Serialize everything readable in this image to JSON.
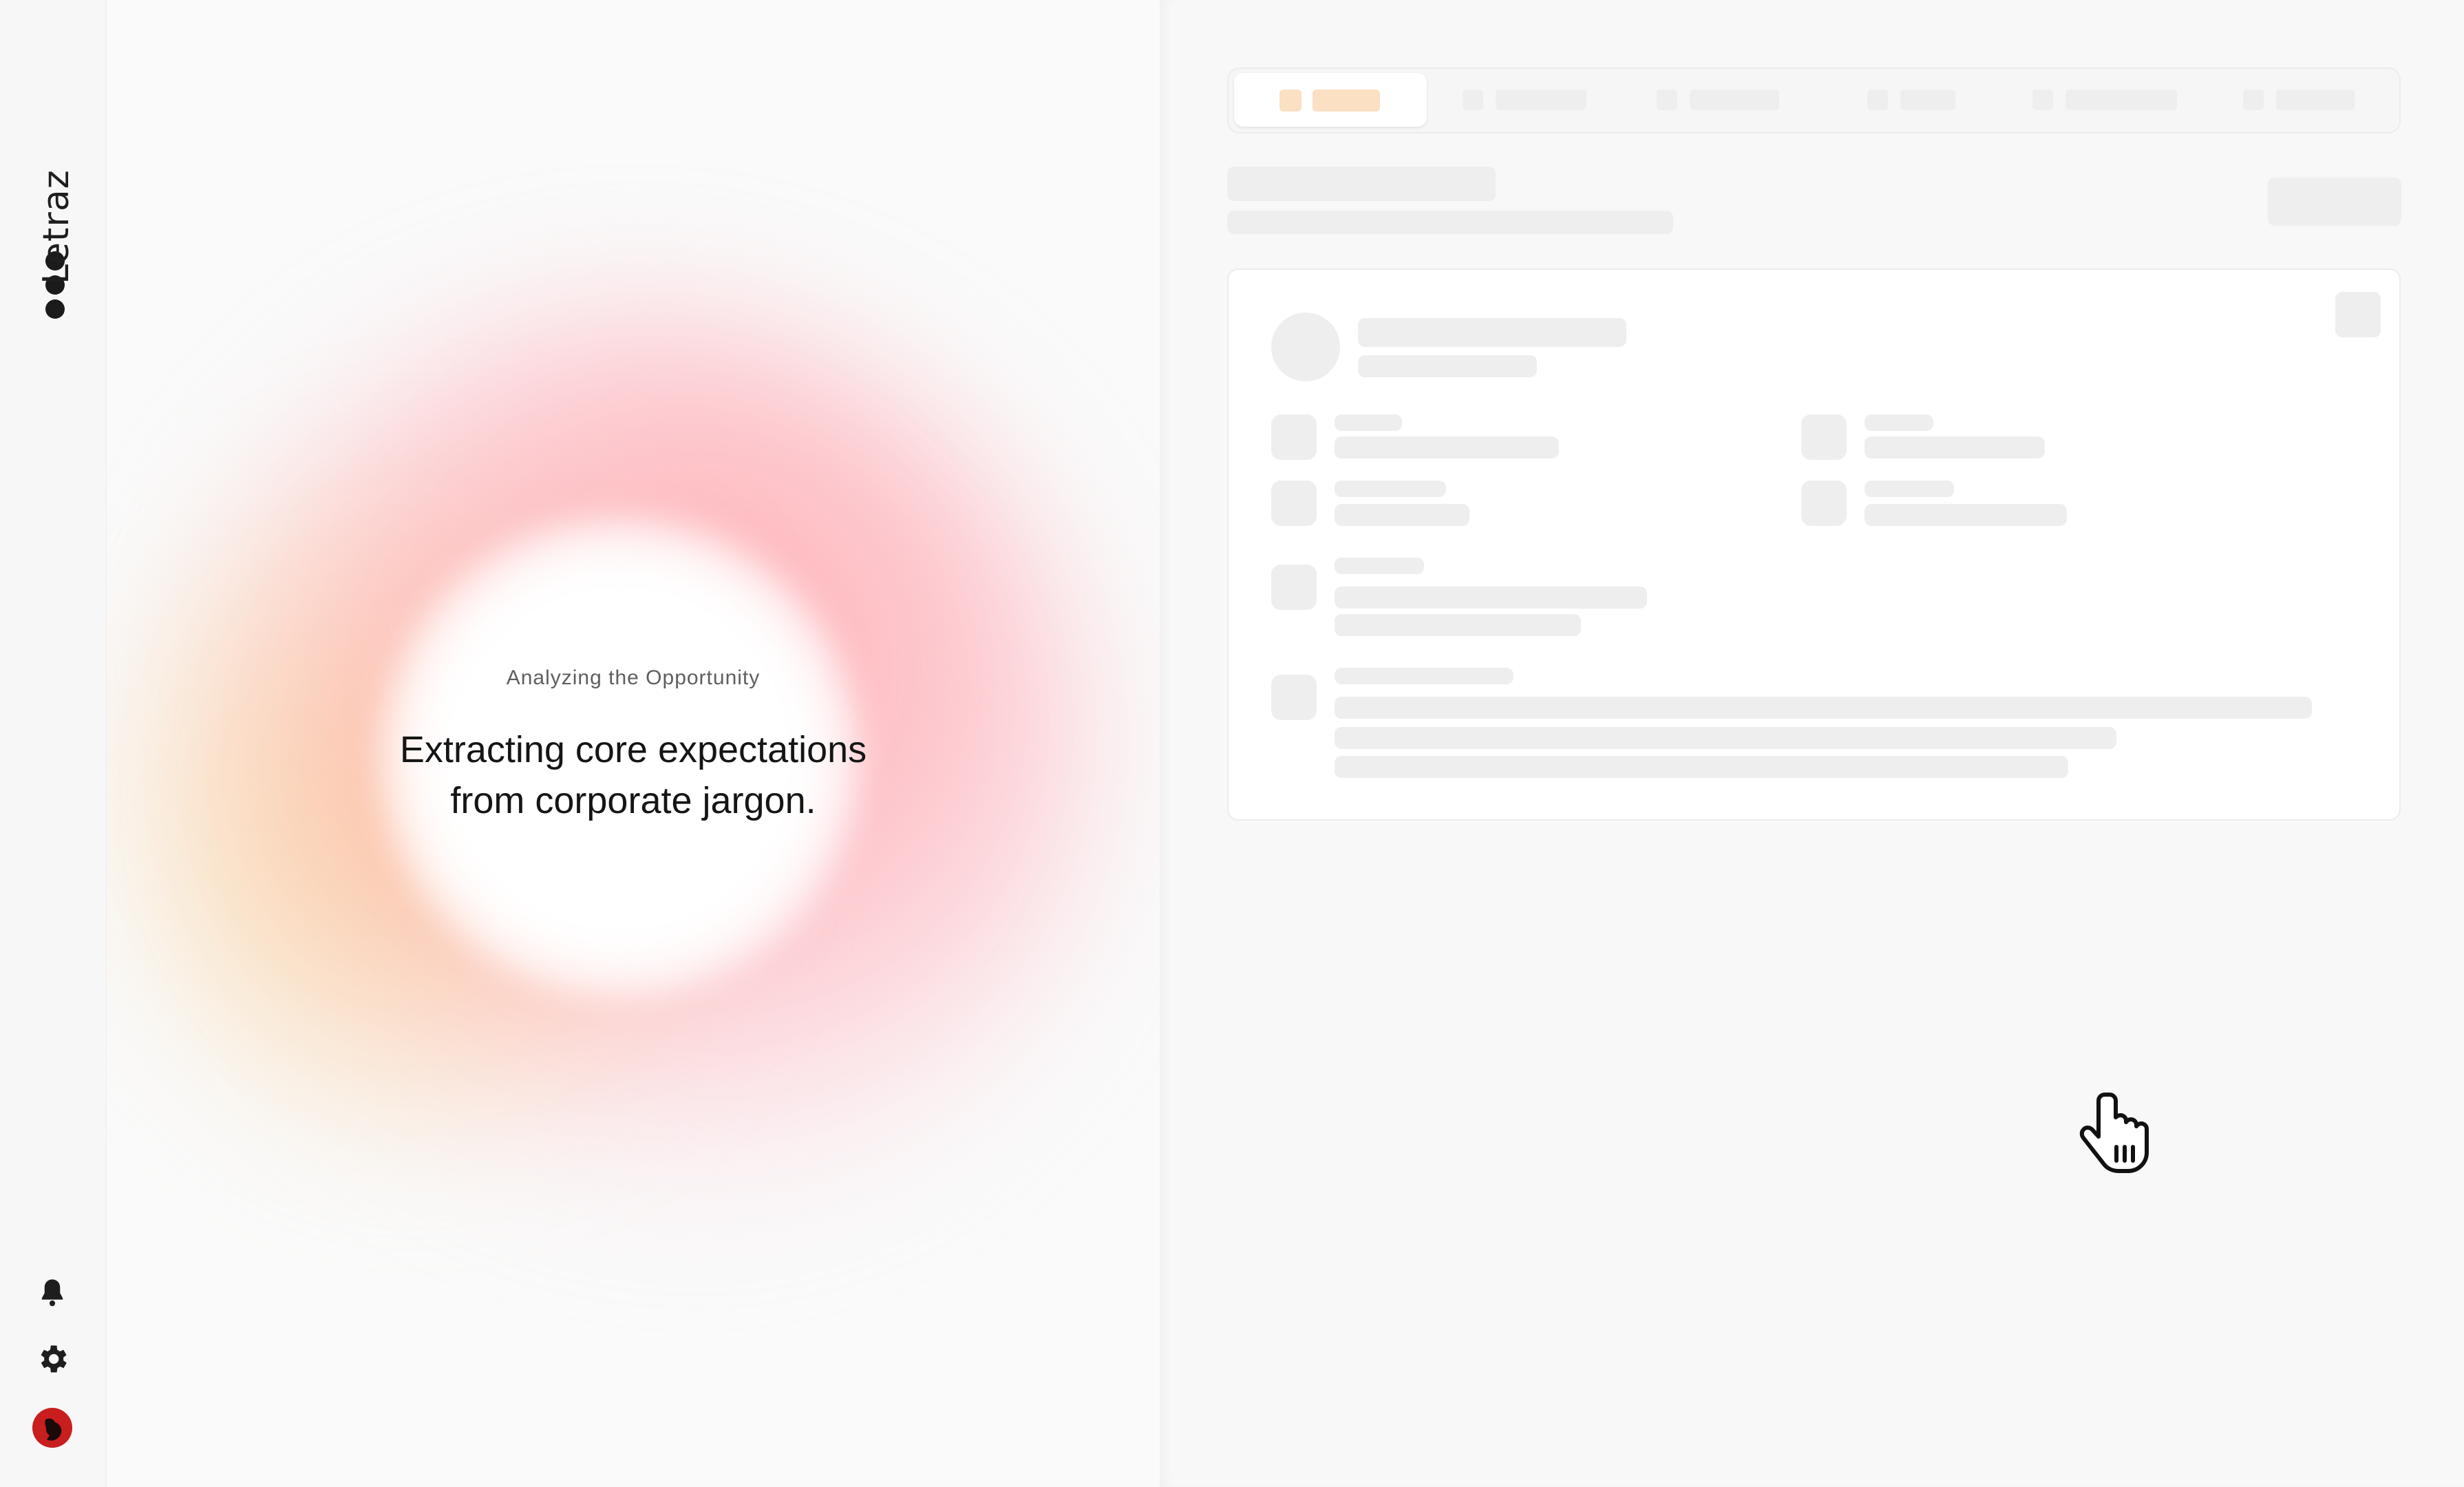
{
  "app": {
    "brand_name": "Letraz"
  },
  "rail": {
    "icons": [
      "bell-icon",
      "gear-icon",
      "avatar"
    ]
  },
  "status": {
    "eyebrow": "Analyzing the Opportunity",
    "headline": "Extracting core expectations from corporate jargon."
  },
  "right_panel": {
    "state": "loading-skeleton",
    "tab_count": 6
  },
  "colors": {
    "accent_peach": "#fbe0c4",
    "glow_rose": "#ffa0a5",
    "glow_gold": "#f7cd82",
    "avatar_red": "#c81e1e"
  }
}
